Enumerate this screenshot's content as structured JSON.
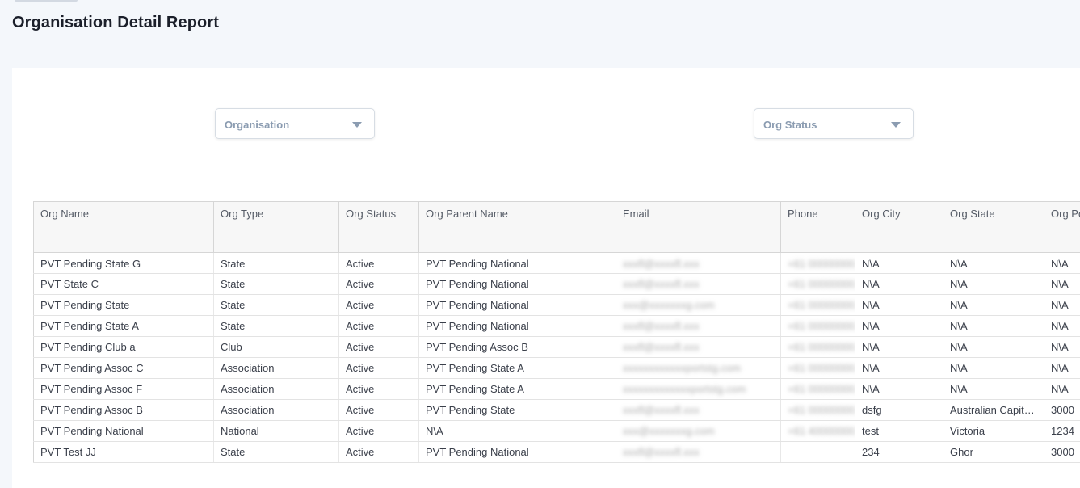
{
  "page": {
    "title": "Organisation Detail Report"
  },
  "filters": {
    "organisation": {
      "label": "Organisation"
    },
    "org_status": {
      "label": "Org Status"
    }
  },
  "table": {
    "columns": [
      "Org Name",
      "Org Type",
      "Org Status",
      "Org Parent Name",
      "Email",
      "Phone",
      "Org City",
      "Org State",
      "Org Po"
    ],
    "rows": [
      {
        "org_name": "PVT Pending State G",
        "org_type": "State",
        "org_status": "Active",
        "parent": "PVT Pending National",
        "email": "xxxfl@xxxxfl.xxx",
        "phone": "+61 00000000",
        "city": "N\\A",
        "state": "N\\A",
        "postcode": "N\\A"
      },
      {
        "org_name": "PVT State C",
        "org_type": "State",
        "org_status": "Active",
        "parent": "PVT Pending National",
        "email": "xxxfl@xxxxfl.xxx",
        "phone": "+61 00000000",
        "city": "N\\A",
        "state": "N\\A",
        "postcode": "N\\A"
      },
      {
        "org_name": "PVT Pending State",
        "org_type": "State",
        "org_status": "Active",
        "parent": "PVT Pending National",
        "email": "xxx@xxxxxxxg.com",
        "phone": "+61 00000000",
        "city": "N\\A",
        "state": "N\\A",
        "postcode": "N\\A"
      },
      {
        "org_name": "PVT Pending State A",
        "org_type": "State",
        "org_status": "Active",
        "parent": "PVT Pending National",
        "email": "xxxfl@xxxxfl.xxx",
        "phone": "+61 00000000",
        "city": "N\\A",
        "state": "N\\A",
        "postcode": "N\\A"
      },
      {
        "org_name": "PVT Pending Club a",
        "org_type": "Club",
        "org_status": "Active",
        "parent": "PVT Pending Assoc B",
        "email": "xxxfl@xxxxfl.xxx",
        "phone": "+61 00000000",
        "city": "N\\A",
        "state": "N\\A",
        "postcode": "N\\A"
      },
      {
        "org_name": "PVT Pending Assoc C",
        "org_type": "Association",
        "org_status": "Active",
        "parent": "PVT Pending State A",
        "email": "xxxxxxxxxxxxportstg.com",
        "phone": "+61 00000000",
        "city": "N\\A",
        "state": "N\\A",
        "postcode": "N\\A"
      },
      {
        "org_name": "PVT Pending Assoc F",
        "org_type": "Association",
        "org_status": "Active",
        "parent": "PVT Pending State A",
        "email": "xxxxxxxxxxxxxportstg.com",
        "phone": "+61 00000000",
        "city": "N\\A",
        "state": "N\\A",
        "postcode": "N\\A"
      },
      {
        "org_name": "PVT Pending Assoc B",
        "org_type": "Association",
        "org_status": "Active",
        "parent": "PVT Pending State",
        "email": "xxxfl@xxxxfl.xxx",
        "phone": "+61 00000000",
        "city": "dsfg",
        "state": "Australian Capital Territory",
        "postcode": "3000"
      },
      {
        "org_name": "PVT Pending National",
        "org_type": "National",
        "org_status": "Active",
        "parent": "N\\A",
        "email": "xxx@xxxxxxxg.com",
        "phone": "+61 40000000",
        "city": "test",
        "state": "Victoria",
        "postcode": "1234"
      },
      {
        "org_name": "PVT Test JJ",
        "org_type": "State",
        "org_status": "Active",
        "parent": "PVT Pending National",
        "email": "xxxfl@xxxxfl.xxx",
        "phone": "",
        "city": "234",
        "state": "Ghor",
        "postcode": "3000"
      }
    ]
  }
}
